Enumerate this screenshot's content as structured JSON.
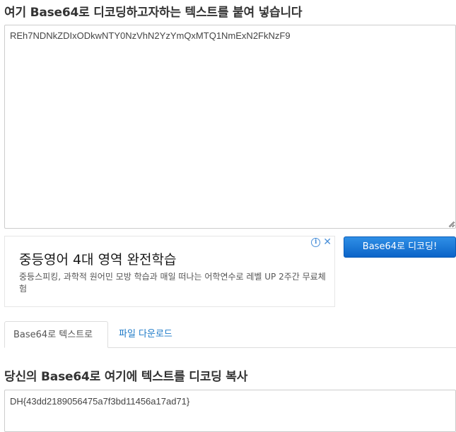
{
  "input_section": {
    "title": "여기 Base64로 디코딩하고자하는 텍스트를 붙여 넣습니다",
    "textarea_value": "REh7NDNkZDIxODkwNTY0NzVhN2YzYmQxMTQ1NmExN2FkNzF9"
  },
  "ad": {
    "headline": "중등영어 4대 영역 완전학습",
    "description": "중등스피킹, 과학적 원어민 모방 학습과 매일 떠나는 어학연수로 레벨 UP 2주간 무료체험",
    "info_icon": "i",
    "close_icon": "✕",
    "accent": "#4a90d9"
  },
  "actions": {
    "decode_button": "Base64로 디코딩!"
  },
  "tabs": [
    {
      "label": "Base64로 텍스트로",
      "active": true
    },
    {
      "label": "파일 다운로드",
      "active": false
    }
  ],
  "output_section": {
    "title": "당신의 Base64로 여기에 텍스트를 디코딩 복사",
    "textarea_value": "DH{43dd2189056475a7f3bd11456a17ad71}"
  },
  "colors": {
    "button_primary": "#0b64c8",
    "link": "#1e7ac8"
  }
}
